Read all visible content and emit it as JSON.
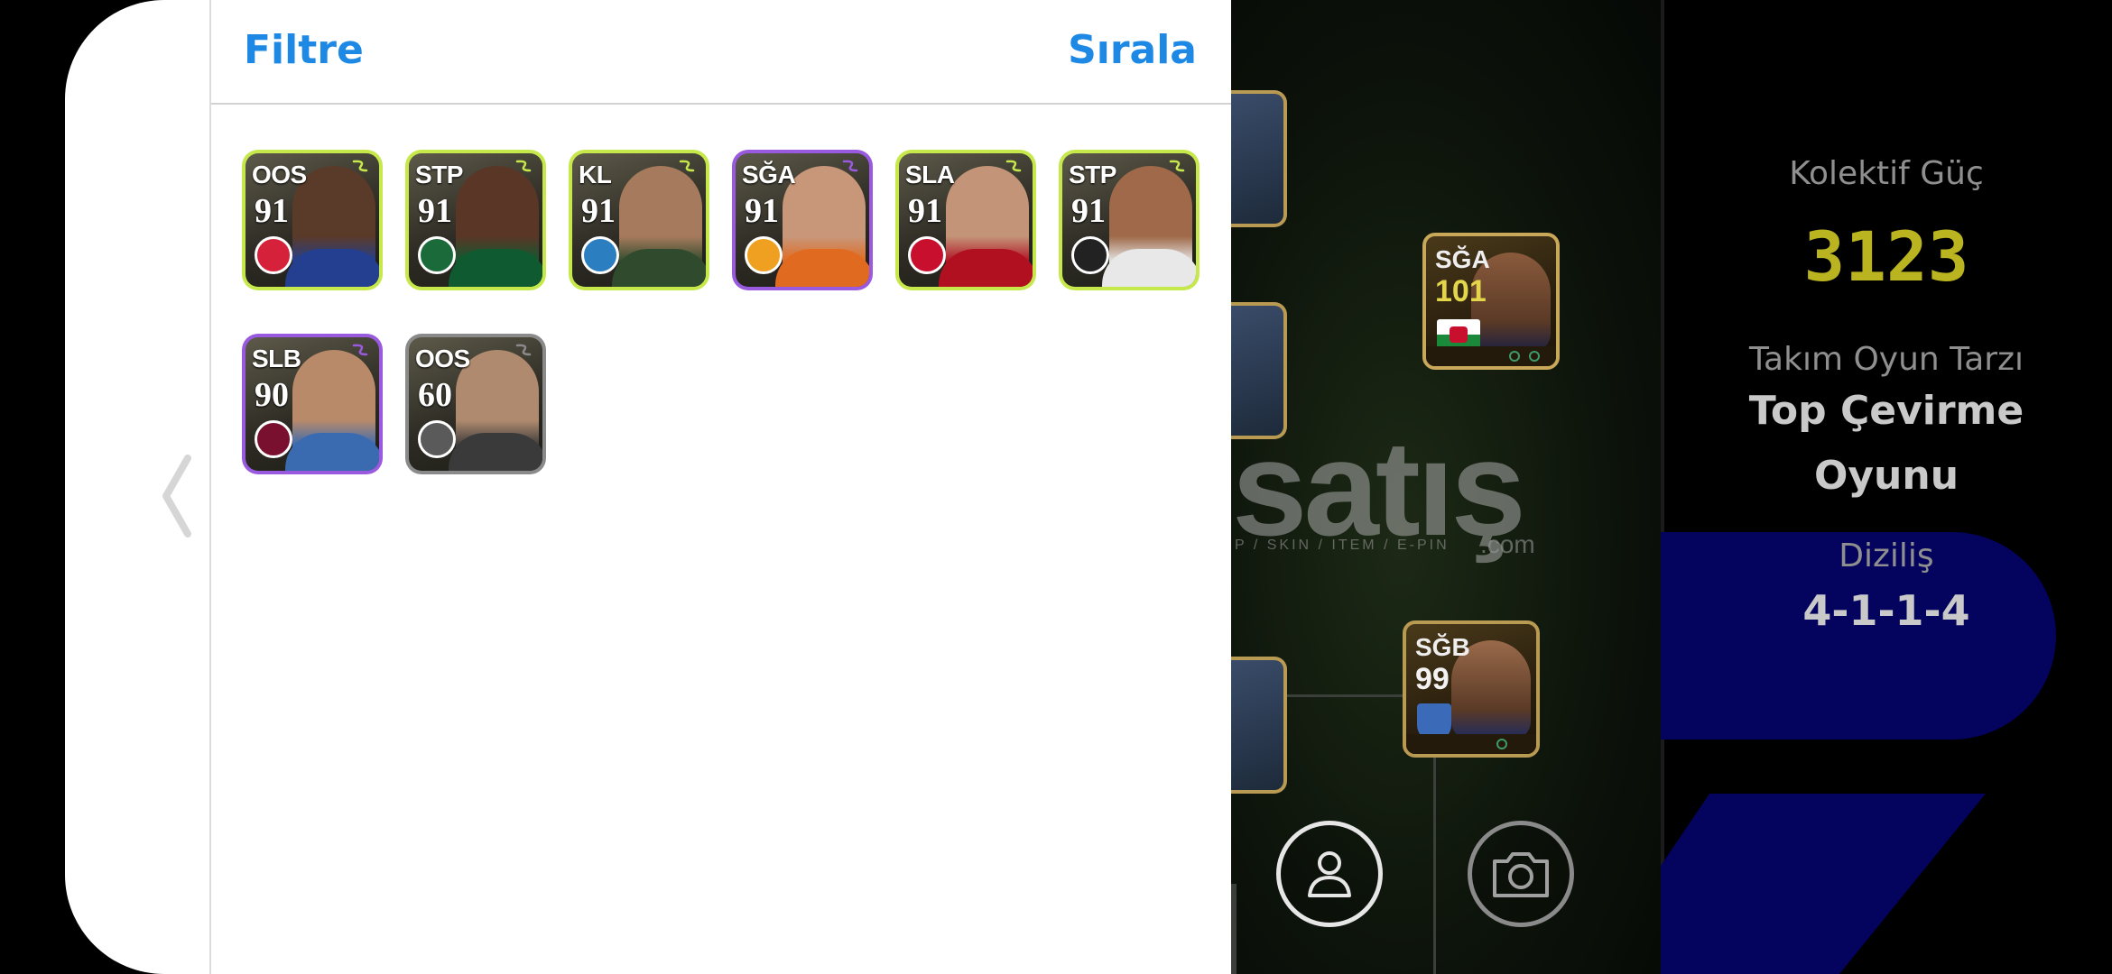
{
  "sheet": {
    "toolbar": {
      "filter_label": "Filtre",
      "sort_label": "Sırala"
    },
    "cards": [
      {
        "position": "OOS",
        "rating": "91",
        "frame": "#c6e84a",
        "club_color": "#d6213a",
        "shirt": "#243f8f",
        "skin": "#5a3a28"
      },
      {
        "position": "STP",
        "rating": "91",
        "frame": "#c6e84a",
        "club_color": "#1b6b3a",
        "shirt": "#0f5a30",
        "skin": "#5a3626"
      },
      {
        "position": "KL",
        "rating": "91",
        "frame": "#c6e84a",
        "club_color": "#2b7ec0",
        "shirt": "#2f4a2c",
        "skin": "#a67a5c"
      },
      {
        "position": "SĞA",
        "rating": "91",
        "frame": "#9a5ae0",
        "club_color": "#f0a020",
        "shirt": "#e06a20",
        "skin": "#c8977a"
      },
      {
        "position": "SLA",
        "rating": "91",
        "frame": "#c6e84a",
        "club_color": "#c8102e",
        "shirt": "#b01020",
        "skin": "#c49478"
      },
      {
        "position": "STP",
        "rating": "91",
        "frame": "#c6e84a",
        "club_color": "#222222",
        "shirt": "#e8e8e8",
        "skin": "#a06a4a"
      },
      {
        "position": "SLB",
        "rating": "90",
        "frame": "#9a5ae0",
        "club_color": "#7a1030",
        "shirt": "#3a6ab0",
        "skin": "#b88a6a"
      },
      {
        "position": "OOS",
        "rating": "60",
        "frame": "#8a8a8a",
        "club_color": "#5a5a5a",
        "shirt": "#3a3a3a",
        "skin": "#b08a6e"
      }
    ]
  },
  "background": {
    "cards": [
      {
        "position": "SĞA",
        "rating": "101"
      },
      {
        "position": "SĞB",
        "rating": "99"
      }
    ],
    "watermark": {
      "main": "satış",
      "sub": "P / SKIN / ITEM / E-PIN",
      "suffix": ".com"
    },
    "stats": {
      "collective_label": "Kolektif Güç",
      "collective_value": "3123",
      "style_label": "Takım Oyun Tarzı",
      "style_value_line1": "Top Çevirme",
      "style_value_line2": "Oyunu",
      "formation_label": "Diziliş",
      "formation_value": "4-1-1-4"
    },
    "colors": {
      "collective": "#b9b41f",
      "panel_blue": "#04035d",
      "link_blue": "#1e88e5"
    },
    "icons": {
      "profile": "person-icon",
      "camera": "camera-icon",
      "back": "chevron-left-icon"
    }
  }
}
